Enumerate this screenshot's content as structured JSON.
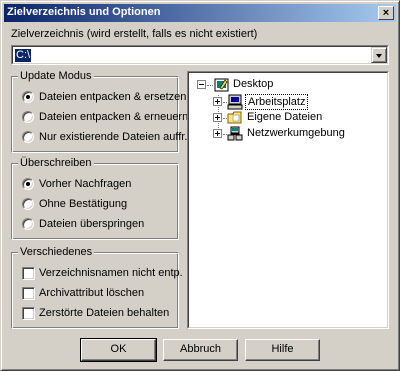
{
  "dialog": {
    "title": "Zielverzeichnis und Optionen",
    "close_glyph": "×"
  },
  "target": {
    "label": "Zielverzeichnis (wird erstellt, falls es nicht existiert)",
    "value": "C:\\"
  },
  "update_mode": {
    "legend": "Update Modus",
    "options": [
      {
        "label": "Dateien entpacken & ersetzen",
        "checked": true
      },
      {
        "label": "Dateien entpacken & erneuern",
        "checked": false
      },
      {
        "label": "Nur existierende Dateien auffr.",
        "checked": false
      }
    ]
  },
  "overwrite": {
    "legend": "Überschreiben",
    "options": [
      {
        "label": "Vorher Nachfragen",
        "checked": true
      },
      {
        "label": "Ohne Bestätigung",
        "checked": false
      },
      {
        "label": "Dateien überspringen",
        "checked": false
      }
    ]
  },
  "misc": {
    "legend": "Verschiedenes",
    "options": [
      {
        "label": "Verzeichnisnamen nicht entp.",
        "checked": false
      },
      {
        "label": "Archivattribut löschen",
        "checked": false
      },
      {
        "label": "Zerstörte Dateien behalten",
        "checked": false
      }
    ]
  },
  "tree": {
    "root": {
      "label": "Desktop",
      "icon": "desktop-icon"
    },
    "children": [
      {
        "label": "Arbeitsplatz",
        "icon": "computer-icon",
        "selected": true
      },
      {
        "label": "Eigene Dateien",
        "icon": "folder-icon",
        "selected": false
      },
      {
        "label": "Netzwerkumgebung",
        "icon": "network-icon",
        "selected": false
      }
    ]
  },
  "buttons": {
    "ok": "OK",
    "cancel": "Abbruch",
    "help": "Hilfe"
  },
  "colors": {
    "title_bar": "#0a246a",
    "face": "#d4d0c8",
    "selection": "#0a246a"
  }
}
